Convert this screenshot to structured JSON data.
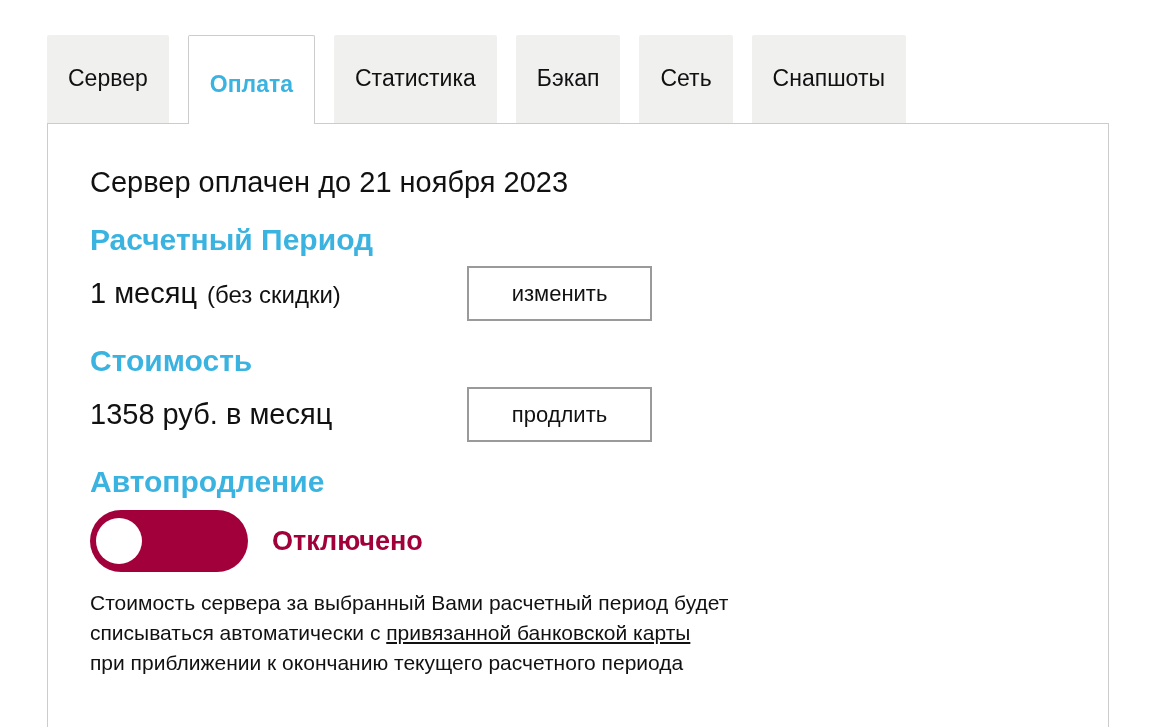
{
  "tabs": [
    {
      "label": "Сервер",
      "selected": false
    },
    {
      "label": "Оплата",
      "selected": true
    },
    {
      "label": "Статистика",
      "selected": false
    },
    {
      "label": "Бэкап",
      "selected": false
    },
    {
      "label": "Сеть",
      "selected": false
    },
    {
      "label": "Снапшоты",
      "selected": false
    }
  ],
  "paid_until": "Сервер оплачен до 21 ноября 2023",
  "period": {
    "heading": "Расчетный Период",
    "value": "1 месяц",
    "note": "(без скидки)",
    "button": "изменить"
  },
  "cost": {
    "heading": "Стоимость",
    "value": "1358 руб. в месяц",
    "button": "продлить"
  },
  "autorenew": {
    "heading": "Автопродление",
    "on": false,
    "status": "Отключено"
  },
  "note": {
    "line_1": "Стоимость сервера за выбранный Вами расчетный период будет",
    "line_2": "списываться автоматически с",
    "link": "привязанной банковской карты",
    "line_3": "при приближении к окончанию текущего расчетного периода"
  }
}
